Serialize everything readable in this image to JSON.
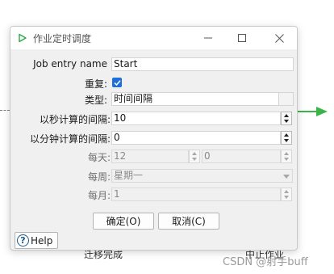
{
  "background": {
    "left_caption": "迁移完成",
    "right_caption": "中止作业",
    "watermark": "CSDN @射手buff",
    "arrow_color": "#39b54a"
  },
  "dialog": {
    "title": "作业定时调度",
    "title_icon": "play-triangle-icon",
    "accent_color": "#1e6fd9",
    "fields": {
      "job_entry_name": {
        "label": "Job entry name",
        "value": "Start"
      },
      "repeat": {
        "label": "重复:",
        "checked": true
      },
      "type": {
        "label": "类型:",
        "value": "时间间隔"
      },
      "interval_seconds": {
        "label": "以秒计算的间隔:",
        "value": "10"
      },
      "interval_minutes": {
        "label": "以分钟计算的间隔:",
        "value": "0"
      },
      "daily": {
        "label": "每天:",
        "hour": "12",
        "minute": "0"
      },
      "weekly": {
        "label": "每周:",
        "value": "星期一"
      },
      "monthly": {
        "label": "每月:",
        "value": "1"
      }
    },
    "buttons": {
      "ok": "确定(O)",
      "cancel": "取消(C)",
      "help": "Help"
    }
  }
}
